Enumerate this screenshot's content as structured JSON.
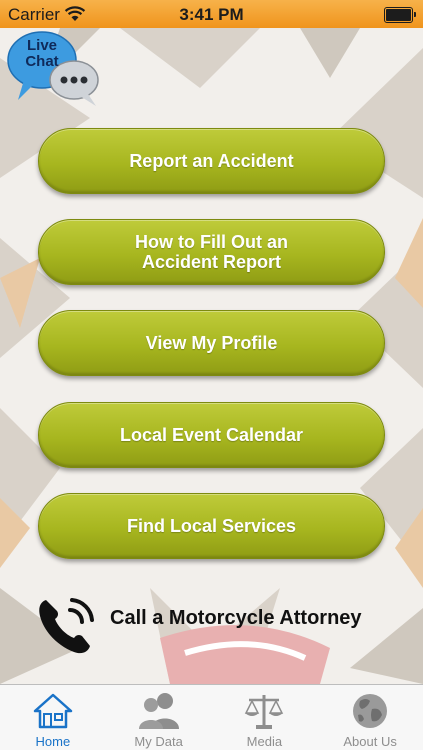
{
  "status_bar": {
    "carrier": "Carrier",
    "time": "3:41 PM"
  },
  "live_chat": {
    "line1": "Live",
    "line2": "Chat"
  },
  "menu": [
    {
      "id": "report-accident",
      "label": "Report an Accident"
    },
    {
      "id": "fill-out-report",
      "label": "How to Fill Out an\nAccident Report"
    },
    {
      "id": "view-profile",
      "label": "View My Profile"
    },
    {
      "id": "event-calendar",
      "label": "Local Event Calendar"
    },
    {
      "id": "local-services",
      "label": "Find Local Services"
    }
  ],
  "call": {
    "label": "Call a Motorcycle Attorney"
  },
  "tabs": [
    {
      "label": "Home",
      "icon": "home-icon",
      "active": true
    },
    {
      "label": "My Data",
      "icon": "people-icon",
      "active": false
    },
    {
      "label": "Media",
      "icon": "scales-icon",
      "active": false
    },
    {
      "label": "About Us",
      "icon": "globe-icon",
      "active": false
    }
  ],
  "colors": {
    "accent": "#1a73c8",
    "button": "#a7b61f",
    "status_bar": "#f0941c"
  }
}
